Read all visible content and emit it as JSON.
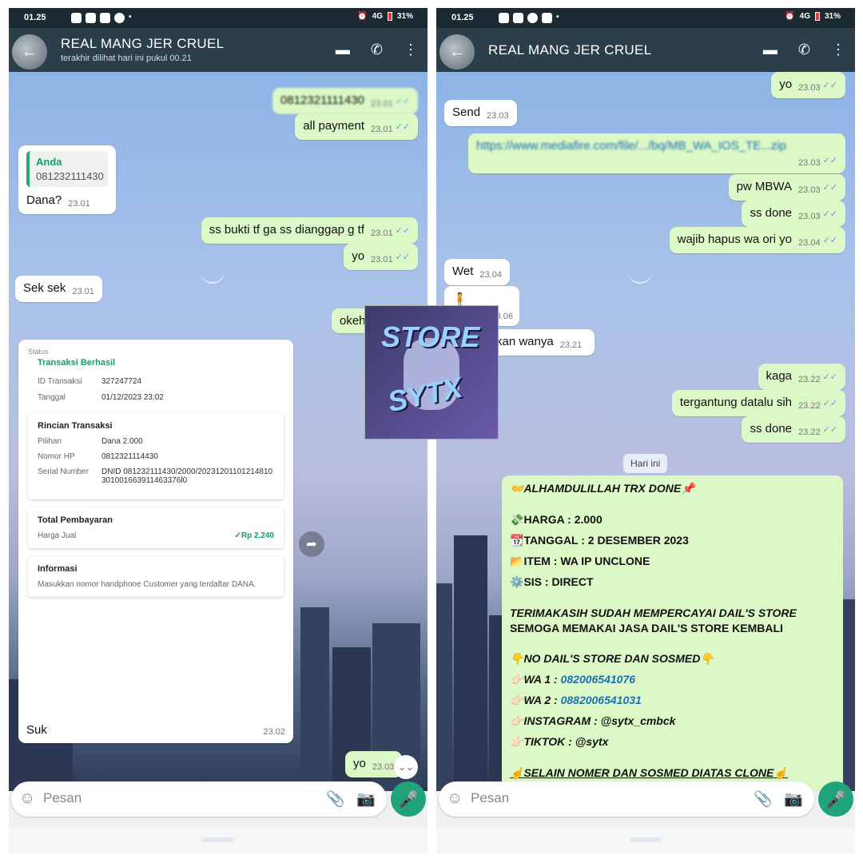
{
  "left": {
    "status": {
      "time": "01.25",
      "battery": "31%",
      "signal": "4G"
    },
    "header": {
      "name": "REAL MANG JER CRUEL",
      "last_seen": "terakhir dilihat hari ini pukul 00.21"
    },
    "messages": {
      "m1": {
        "text": "0812321111430",
        "time": "23.01"
      },
      "m2": {
        "text": "all payment",
        "time": "23.01"
      },
      "m3": {
        "quote_name": "Anda",
        "quote_text": "081232111430",
        "text": "Dana?",
        "time": "23.01"
      },
      "m4": {
        "text": "ss bukti tf ga ss dianggap g tf",
        "time": "23.01"
      },
      "m5": {
        "text": "yo",
        "time": "23.01"
      },
      "m6": {
        "text": "Sek sek",
        "time": "23.01"
      },
      "m7": {
        "text": "okeh",
        "time": ""
      },
      "m8": {
        "text": "Suk",
        "time": "23.02"
      },
      "m9": {
        "text": "yo",
        "time": "23.03"
      }
    },
    "receipt": {
      "status_label": "Status",
      "status": "Transaksi Berhasil",
      "id_label": "ID Transaksi",
      "id_value": "327247724",
      "date_label": "Tanggal",
      "date_value": "01/12/2023 23:02",
      "detail_title": "Rincian Transaksi",
      "pilihan_label": "Pilihan",
      "pilihan_value": "Dana 2.000",
      "nomor_label": "Nomor HP",
      "nomor_value": "0812321114430",
      "serial_label": "Serial Number",
      "serial_value": "DNID 081232111430/2000/20231201101214810301001663911463376l0",
      "total_title": "Total Pembayaran",
      "harga_label": "Harga Jual",
      "harga_value": "✓Rp 2.240",
      "info_title": "Informasi",
      "info_text": "Masukkan nomor handphone Customer yang terdaftar DANA."
    },
    "sticker": {
      "text1": "STORE",
      "text2": "SYTX"
    },
    "input": {
      "placeholder": "Pesan"
    }
  },
  "right": {
    "status": {
      "time": "01.25",
      "battery": "31%",
      "signal": "4G"
    },
    "header": {
      "name": "REAL MANG JER CRUEL"
    },
    "messages": {
      "r1": {
        "text": "yo",
        "time": "23.03"
      },
      "r2": {
        "text": "Send",
        "time": "23.03"
      },
      "r3": {
        "text": "https://www.mediafire.com/file/.../bq/MB_WA_IOS_TE...zip",
        "time": "23.03"
      },
      "r4": {
        "text": "pw MBWA",
        "time": "23.03"
      },
      "r5": {
        "text": "ss done",
        "time": "23.03"
      },
      "r6": {
        "text": "wajib hapus wa ori yo",
        "time": "23.04"
      },
      "r7": {
        "text": "Wet",
        "time": "23.04"
      },
      "r8": {
        "text": "",
        "time": "23.06"
      },
      "r9": {
        "text": "kan wanya",
        "time": "23.21"
      },
      "r10": {
        "text": "kaga",
        "time": "23.22"
      },
      "r11": {
        "text": "tergantung datalu sih",
        "time": "23.22"
      },
      "r12": {
        "text": "ss done",
        "time": "23.22"
      }
    },
    "day_label": "Hari ini",
    "promo": {
      "l1": "ALHAMDULILLAH TRX DONE",
      "l2": "HARGA : 2.000",
      "l3": "TANGGAL : 2 DESEMBER 2023",
      "l4": "ITEM : WA IP UNCLONE",
      "l5": "SIS : DIRECT",
      "l6": "TERIMAKASIH SUDAH MEMPERCAYAI DAIL'S STORE",
      "l7": "SEMOGA MEMAKAI JASA DAIL'S STORE KEMBALI",
      "l8": "NO DAIL'S STORE DAN SOSMED",
      "wa1_label": "WA 1 : ",
      "wa1": "082006541076",
      "wa2_label": "WA 2 : ",
      "wa2": "0882006541031",
      "ig": "INSTAGRAM : @sytx_cmbck",
      "tt": "TIKTOK : @sytx",
      "l9": "SELAIN NOMER DAN SOSMED DIATAS CLONE"
    },
    "input": {
      "placeholder": "Pesan"
    }
  }
}
